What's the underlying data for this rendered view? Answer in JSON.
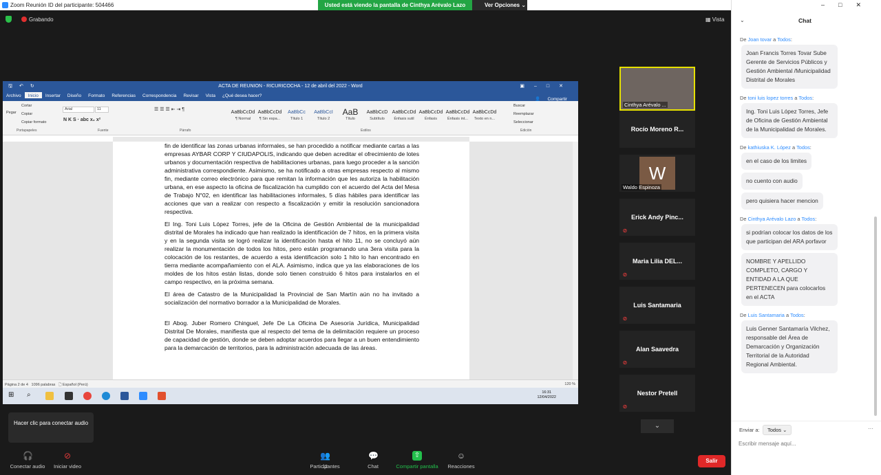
{
  "window": {
    "title": "Zoom Reunión ID del participante: 504466",
    "share_banner": "Usted está viendo la pantalla de Cinthya Arévalo Lazo",
    "view_options": "Ver Opciones",
    "recording": "Grabando",
    "view": "Vista"
  },
  "word": {
    "doc_title": "ACTA DE REUNION - RICURICOCHA - 12 de abril del 2022 - Word",
    "tabs": [
      "Archivo",
      "Inicio",
      "Insertar",
      "Diseño",
      "Formato",
      "Referencias",
      "Correspondencia",
      "Revisar",
      "Vista",
      "¿Qué desea hacer?"
    ],
    "share": "Compartir",
    "clipboard": {
      "paste": "Pegar",
      "cut": "Cortar",
      "copy": "Copiar",
      "format_painter": "Copiar formato"
    },
    "font": "Arial",
    "font_size": "11",
    "styles": [
      {
        "sample": "AaBbCcDd",
        "name": "¶ Normal"
      },
      {
        "sample": "AaBbCcDd",
        "name": "¶ Sin espa..."
      },
      {
        "sample": "AaBbCc",
        "name": "Título 1"
      },
      {
        "sample": "AaBbCcI",
        "name": "Título 2"
      },
      {
        "sample": "AaB",
        "name": "Título"
      },
      {
        "sample": "AaBbCcD",
        "name": "Subtítulo"
      },
      {
        "sample": "AaBbCcDd",
        "name": "Énfasis sutil"
      },
      {
        "sample": "AaBbCcDd",
        "name": "Énfasis"
      },
      {
        "sample": "AaBbCcDd",
        "name": "Énfasis int..."
      },
      {
        "sample": "AaBbCcDd",
        "name": "Texto en n..."
      }
    ],
    "editing": {
      "find": "Buscar",
      "replace": "Reemplazar",
      "select": "Seleccionar"
    },
    "groups": {
      "clipboard": "Portapapeles",
      "font": "Fuente",
      "paragraph": "Párrafo",
      "styles": "Estilos",
      "editing": "Edición"
    },
    "paragraphs": [
      "fin de identificar las zonas urbanas informales, se han procedido a notificar mediante cartas a las empresas AYBAR CORP Y CIUDAPOLIS, indicando que deben acreditar el ofrecimiento de lotes urbanos y documentación respectiva de habilitaciones urbanas, para luego proceder a la sanción administrativa correspondiente. Asimismo, se ha notificado a otras empresas respecto al mismo fin, mediante correo electrónico para que remitan la información que les autoriza la habilitación urbana, en ese aspecto la oficina de fiscalización ha cumplido con el acuerdo del Acta del Mesa de Trabajo N°02, en identificar las habilitaciones informales, 5 días hábiles para identificar las acciones que van a realizar con respecto a fiscalización y emitir la resolución sancionadora respectiva.",
      "El Ing. Toni Luis López Torres, jefe de la Oficina de Gestión Ambiental de la municipalidad distrital de Morales ha indicado que han realizado la identificación de 7 hitos, en la primera visita y en la segunda visita se logró realizar la identificación hasta el hito 11, no se concluyó aún realizar la monumentación de todos los hitos, pero están programando una 3era visita para la colocación de los restantes, de acuerdo a esta identificación solo 1 hito lo han encontrado en tierra mediante acompañamiento con el ALA. Asimismo, indica que ya las elaboraciones de los moldes de los hitos están listas, donde solo tienen construido 6 hitos para instalarlos en el campo respectivo, en la próxima semana.",
      "El área de Catastro de la Municipalidad la Provincial de San Martín aún no ha invitado a socialización del normativo borrador a la Municipalidad de Morales.",
      "El Abog. Juber Romero Chinguel, Jefe De La Oficina De Asesoría Jurídica, Municipalidad Distrital De Morales, manifiesta que al respecto del tema de la delimitación requiere un proceso de capacidad de gestión, donde se deben adoptar acuerdos para llegar a un buen entendimiento para la demarcación de territorios, para la administración adecuada de las áreas."
    ],
    "status": {
      "page": "Página 2 de 4",
      "words": "1096 palabras",
      "lang": "Español (Perú)",
      "zoom": "120 %"
    },
    "taskbar": {
      "time": "16:31",
      "date": "12/04/2022"
    }
  },
  "participants": [
    {
      "name": "Cinthya Arévalo ...",
      "video": true
    },
    {
      "name": "Rocío Moreno R...",
      "muted": false
    },
    {
      "name": "Waldo Espinoza",
      "initial": "W"
    },
    {
      "name": "Erick Andy Pinc...",
      "muted": true
    },
    {
      "name": "Maria Lilia DEL...",
      "muted": true
    },
    {
      "name": "Luis Santamaria",
      "muted": true
    },
    {
      "name": "Alan Saavedra",
      "muted": true
    },
    {
      "name": "Nestor Pretell",
      "muted": true
    }
  ],
  "tooltip": "Hacer clic para conectar audio",
  "toolbar": {
    "audio": "Conectar audio",
    "video": "Iniciar video",
    "participants": "Participantes",
    "participants_count": "12",
    "chat": "Chat",
    "share": "Compartir pantalla",
    "reactions": "Reacciones",
    "leave": "Salir"
  },
  "chat": {
    "title": "Chat",
    "messages": [
      {
        "from": "Joan tovar",
        "to": "Todos",
        "texts": [
          "Joan Francis Torres Tovar Sube Gerente de Servicios Públicos y Gestión Ambiental /Municipalidad Distrital de Morales"
        ]
      },
      {
        "from": "toni luis lopez torres",
        "to": "Todos",
        "texts": [
          "Ing. Toni Luis López Torres, Jefe de Oficina de Gestión Ambiental de la Municipalidad de Morales."
        ]
      },
      {
        "from": "kathiuska K. López",
        "to": "Todos",
        "texts": [
          "en el caso de los limites",
          "no cuento con audio",
          "pero quisiera hacer mencion"
        ]
      },
      {
        "from": "Cinthya Arévalo Lazo",
        "to": "Todos",
        "texts": [
          "si podrían colocar los datos de los que participan del ARA porfavor",
          "NOMBRE Y APELLIDO COMPLETO, CARGO Y ENTIDAD A LA QUE PERTENECEN para colocarlos en el ACTA"
        ]
      },
      {
        "from": "Luis Santamaria",
        "to": "Todos",
        "texts": [
          "Luis Genner Santamaría Vilchez, responsable del Área de Demarcación y Organización Territorial de la Autoridad Regional Ambiental."
        ]
      }
    ],
    "send_to_label": "Enviar a:",
    "send_to_value": "Todos",
    "input_placeholder": "Escribir mensaje aquí..."
  }
}
